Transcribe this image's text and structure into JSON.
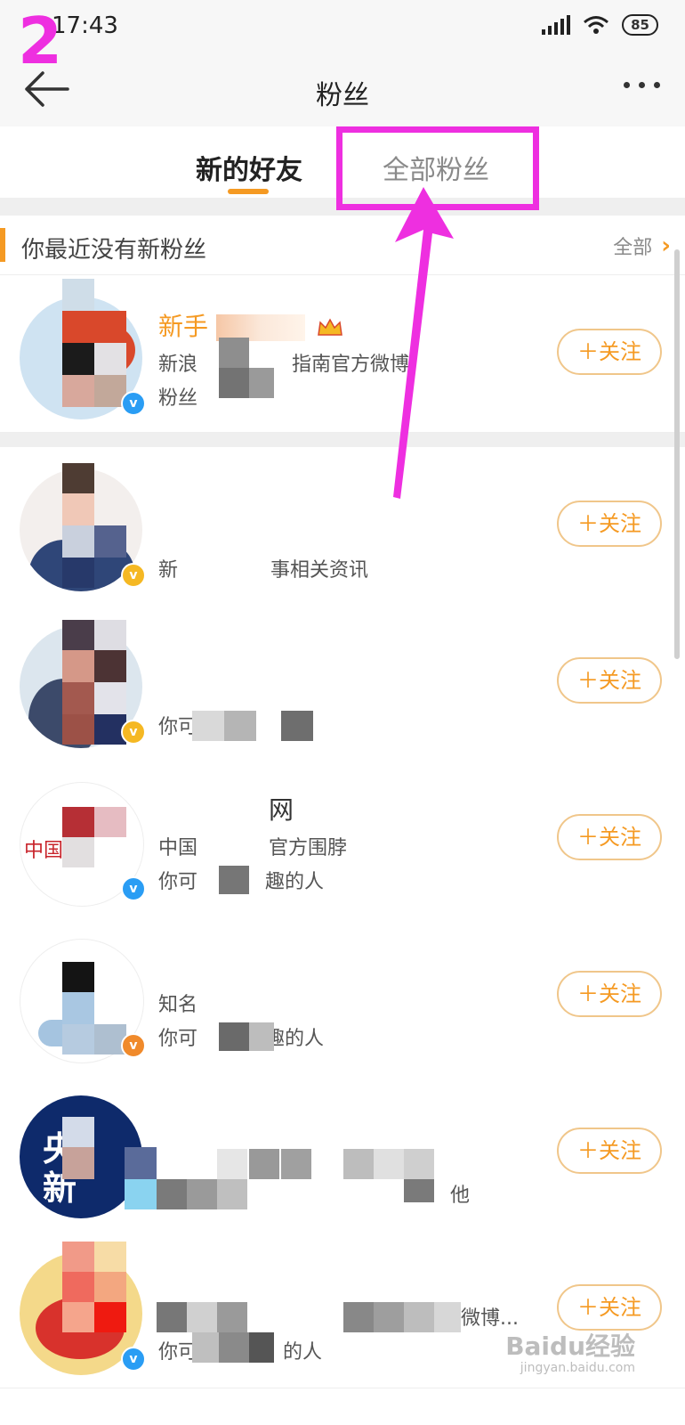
{
  "step_number": "2",
  "status_bar": {
    "time": "17:43",
    "battery": "85"
  },
  "header": {
    "title": "粉丝"
  },
  "tabs": [
    {
      "label": "新的好友"
    },
    {
      "label": "全部粉丝"
    }
  ],
  "notice": {
    "text": "你最近没有新粉丝",
    "all_label": "全部"
  },
  "users": [
    {
      "name": "新手",
      "line1": "新浪",
      "line1b": "指南官方微博",
      "line2": "粉丝"
    },
    {
      "line1": "新",
      "line1b": "事相关资讯"
    },
    {
      "line1": "你可"
    },
    {
      "name_suffix": "网",
      "line1": "中国",
      "line1b": "官方围脖",
      "line2": "你可",
      "line2b": "趣的人"
    },
    {
      "line1": "知名",
      "line2": "你可",
      "line2b": "趣的人"
    },
    {
      "line1b": "他"
    },
    {
      "line1b": "微博...",
      "line2": "你可",
      "line2b": "的人"
    }
  ],
  "follow_label": "＋关注",
  "watermark": {
    "main": "Baidu经验",
    "sub": "jingyan.baidu.com"
  },
  "colors": {
    "accent": "#f59a23",
    "highlight": "#ee2fe0",
    "verified_blue": "#2a9df4",
    "verified_gold": "#f5b823"
  }
}
